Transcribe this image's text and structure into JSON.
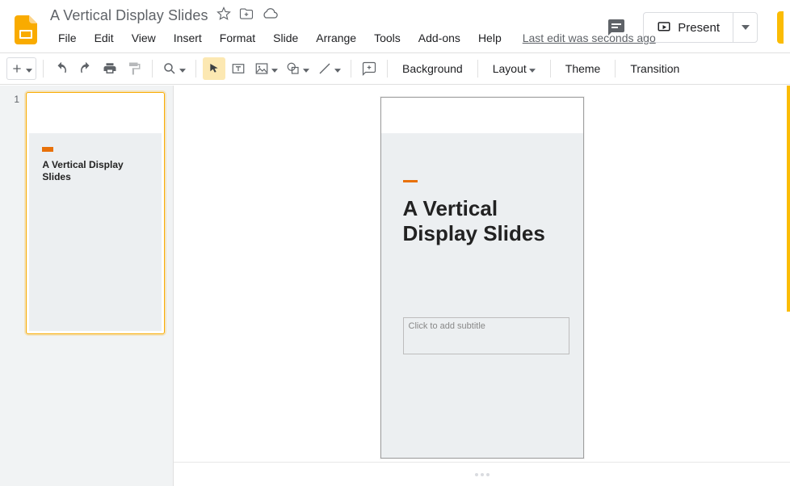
{
  "doc": {
    "title": "A Vertical Display Slides",
    "last_edit": "Last edit was seconds ago"
  },
  "menus": [
    "File",
    "Edit",
    "View",
    "Insert",
    "Format",
    "Slide",
    "Arrange",
    "Tools",
    "Add-ons",
    "Help"
  ],
  "toolbar": {
    "background": "Background",
    "layout": "Layout",
    "theme": "Theme",
    "transition": "Transition"
  },
  "present": {
    "label": "Present"
  },
  "filmstrip": {
    "slides": [
      {
        "number": "1",
        "title": "A Vertical Display Slides"
      }
    ]
  },
  "canvas": {
    "title": "A Vertical Display Slides",
    "subtitle_placeholder": "Click to add subtitle"
  }
}
